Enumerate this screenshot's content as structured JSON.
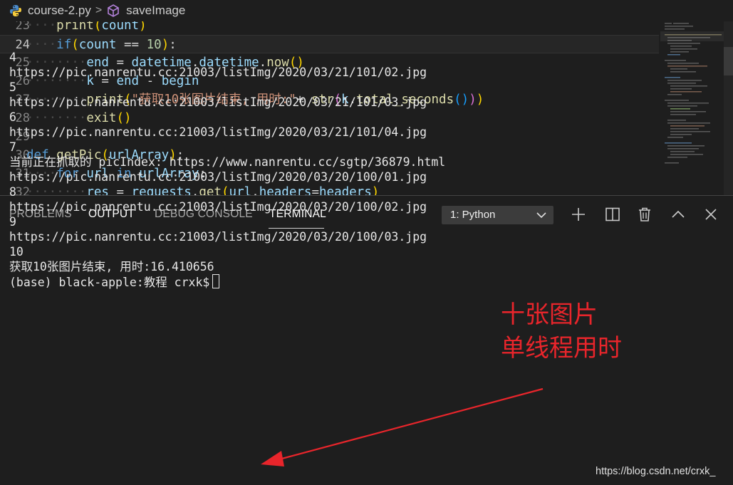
{
  "breadcrumb": {
    "file": "course-2.py",
    "separator": ">",
    "symbol": "saveImage"
  },
  "editor": {
    "lines": [
      {
        "num": "23",
        "indent": 1,
        "tokens": [
          [
            "fn",
            "print"
          ],
          [
            "p1",
            "("
          ],
          [
            "var",
            "count"
          ],
          [
            "p1",
            ")"
          ]
        ]
      },
      {
        "num": "24",
        "indent": 1,
        "current": true,
        "tokens": [
          [
            "kw",
            "if"
          ],
          [
            "p1",
            "("
          ],
          [
            "var",
            "count"
          ],
          [
            "plain",
            " == "
          ],
          [
            "num",
            "10"
          ],
          [
            "p1",
            ")"
          ],
          [
            "plain",
            ":"
          ]
        ]
      },
      {
        "num": "25",
        "indent": 2,
        "tokens": [
          [
            "var",
            "end"
          ],
          [
            "plain",
            " = "
          ],
          [
            "var",
            "datetime"
          ],
          [
            "plain",
            "."
          ],
          [
            "var",
            "datetime"
          ],
          [
            "plain",
            "."
          ],
          [
            "fn",
            "now"
          ],
          [
            "p1",
            "()"
          ]
        ]
      },
      {
        "num": "26",
        "indent": 2,
        "tokens": [
          [
            "var",
            "k"
          ],
          [
            "plain",
            " = "
          ],
          [
            "var",
            "end"
          ],
          [
            "plain",
            " - "
          ],
          [
            "var",
            "begin"
          ]
        ]
      },
      {
        "num": "27",
        "indent": 2,
        "tokens": [
          [
            "fn",
            "print"
          ],
          [
            "p1",
            "("
          ],
          [
            "str",
            "\"获取10张图片结束, 用时:\""
          ],
          [
            "plain",
            "+ "
          ],
          [
            "fn",
            "str"
          ],
          [
            "p2",
            "("
          ],
          [
            "var",
            "k"
          ],
          [
            "plain",
            "."
          ],
          [
            "fn",
            "total_seconds"
          ],
          [
            "p3",
            "()"
          ],
          [
            "p2",
            ")"
          ],
          [
            "p1",
            ")"
          ]
        ]
      },
      {
        "num": "28",
        "indent": 2,
        "tokens": [
          [
            "fn",
            "exit"
          ],
          [
            "p1",
            "()"
          ]
        ]
      },
      {
        "num": "29",
        "indent": 0,
        "tokens": []
      },
      {
        "num": "30",
        "indent": 0,
        "tokens": [
          [
            "kw",
            "def"
          ],
          [
            "plain",
            " "
          ],
          [
            "fn",
            "getPic"
          ],
          [
            "p1",
            "("
          ],
          [
            "var",
            "urlArray"
          ],
          [
            "p1",
            ")"
          ],
          [
            "plain",
            ":"
          ]
        ]
      },
      {
        "num": "31",
        "indent": 1,
        "tokens": [
          [
            "kw",
            "for"
          ],
          [
            "plain",
            " "
          ],
          [
            "var",
            "url"
          ],
          [
            "plain",
            " "
          ],
          [
            "kw",
            "in"
          ],
          [
            "plain",
            " "
          ],
          [
            "var",
            "urlArray"
          ],
          [
            "plain",
            ":"
          ]
        ]
      },
      {
        "num": "32",
        "indent": 2,
        "tokens": [
          [
            "var",
            "res"
          ],
          [
            "plain",
            " = "
          ],
          [
            "var",
            "requests"
          ],
          [
            "plain",
            "."
          ],
          [
            "fn",
            "get"
          ],
          [
            "p1",
            "("
          ],
          [
            "var",
            "url"
          ],
          [
            "plain",
            ","
          ],
          [
            "var",
            "headers"
          ],
          [
            "plain",
            "="
          ],
          [
            "var",
            "headers"
          ],
          [
            "p1",
            ")"
          ]
        ]
      }
    ]
  },
  "panel": {
    "tabs": [
      "PROBLEMS",
      "OUTPUT",
      "DEBUG CONSOLE",
      "TERMINAL"
    ],
    "active_tab": "TERMINAL",
    "terminal_select": "1: Python",
    "icons": [
      "add-icon",
      "split-icon",
      "trash-icon",
      "chevron-up-icon",
      "close-icon"
    ]
  },
  "terminal": {
    "lines": [
      "4",
      "https://pic.nanrentu.cc:21003/listImg/2020/03/21/101/02.jpg",
      "5",
      "https://pic.nanrentu.cc:21003/listImg/2020/03/21/101/03.jpg",
      "6",
      "https://pic.nanrentu.cc:21003/listImg/2020/03/21/101/04.jpg",
      "7",
      "当前正在抓取的 picIndex: https://www.nanrentu.cc/sgtp/36879.html",
      "https://pic.nanrentu.cc:21003/listImg/2020/03/20/100/01.jpg",
      "8",
      "https://pic.nanrentu.cc:21003/listImg/2020/03/20/100/02.jpg",
      "9",
      "https://pic.nanrentu.cc:21003/listImg/2020/03/20/100/03.jpg",
      "10",
      "获取10张图片结束, 用时:16.410656"
    ],
    "prompt": "(base) black-apple:教程 crxk$"
  },
  "annotation": {
    "line1": "十张图片",
    "line2": "单线程用时",
    "color": "#e8252b"
  },
  "watermark": "https://blog.csdn.net/crxk_"
}
